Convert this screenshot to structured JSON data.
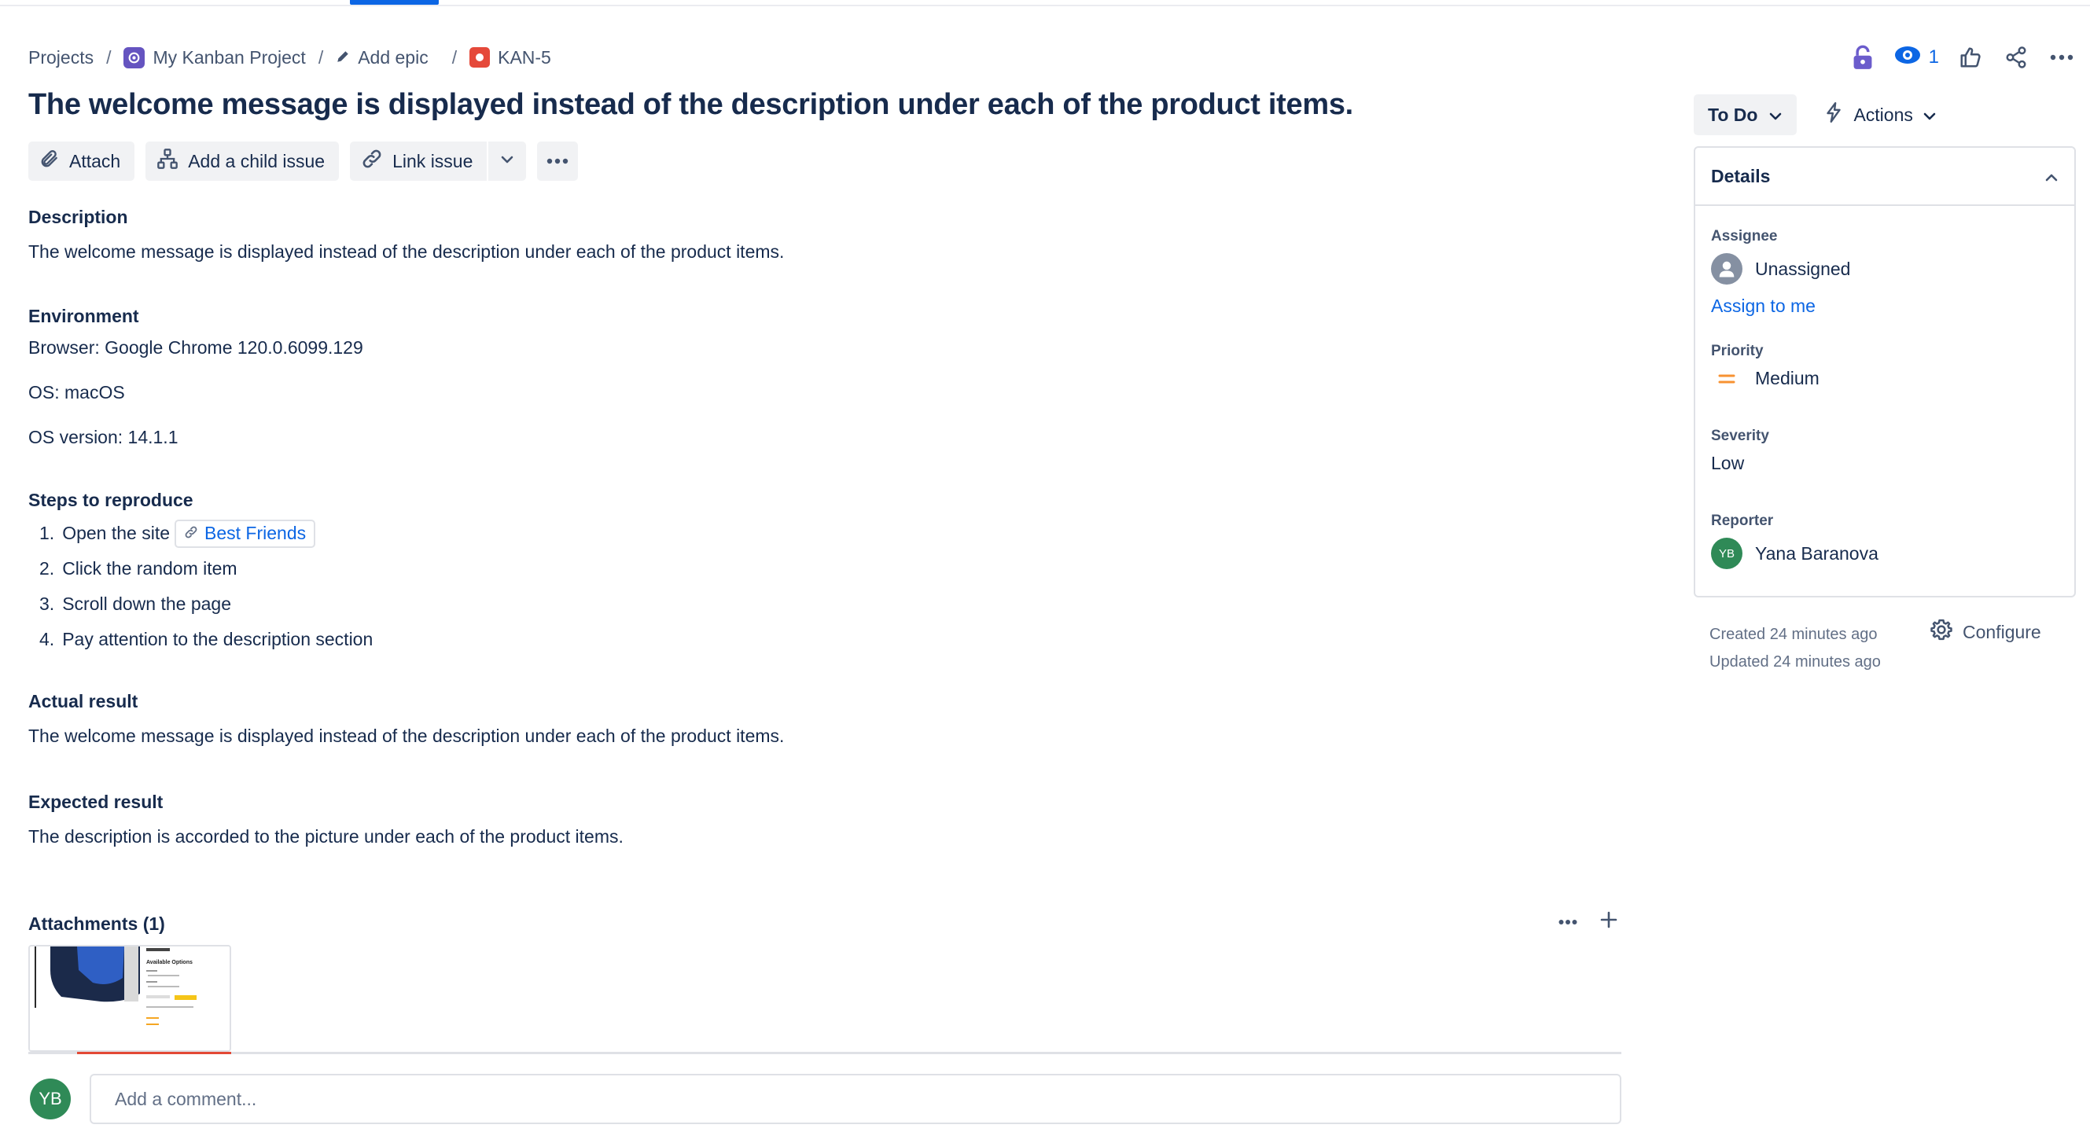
{
  "breadcrumb": {
    "projects": "Projects",
    "project_name": "My Kanban Project",
    "add_epic": "Add epic",
    "issue_key": "KAN-5",
    "separator": "/"
  },
  "top_actions": {
    "watchers_count": "1"
  },
  "issue": {
    "title": "The welcome message is displayed instead of the description under each of the product items."
  },
  "toolbar": {
    "attach": "Attach",
    "add_child": "Add a child issue",
    "link_issue": "Link issue"
  },
  "description": {
    "heading": "Description",
    "text": "The welcome message is displayed instead of the description under each of the product items."
  },
  "environment": {
    "heading": "Environment",
    "browser": "Browser: Google Chrome 120.0.6099.129",
    "os": "OS: macOS",
    "os_version": "OS version: 14.1.1"
  },
  "steps": {
    "heading": "Steps to reproduce",
    "items": [
      {
        "num": "1.",
        "text": "Open the site",
        "link": "Best Friends"
      },
      {
        "num": "2.",
        "text": "Click the random item"
      },
      {
        "num": "3.",
        "text": "Scroll down the page"
      },
      {
        "num": "4.",
        "text": "Pay attention to the description section"
      }
    ]
  },
  "actual": {
    "heading": "Actual result",
    "text": "The welcome message is displayed instead of the description under each of the product items."
  },
  "expected": {
    "heading": "Expected result",
    "text": "The description is accorded to the picture under each of the product items."
  },
  "attachments": {
    "heading": "Attachments (1)",
    "thumb_title": "Available Options"
  },
  "comment": {
    "avatar_initials": "YB",
    "placeholder": "Add a comment..."
  },
  "side": {
    "status": "To Do",
    "actions": "Actions",
    "details_heading": "Details",
    "assignee_label": "Assignee",
    "assignee_value": "Unassigned",
    "assign_to_me": "Assign to me",
    "priority_label": "Priority",
    "priority_value": "Medium",
    "severity_label": "Severity",
    "severity_value": "Low",
    "reporter_label": "Reporter",
    "reporter_initials": "YB",
    "reporter_value": "Yana Baranova",
    "created": "Created 24 minutes ago",
    "updated": "Updated 24 minutes ago",
    "configure": "Configure"
  },
  "colors": {
    "accent": "#0c66e4",
    "priority_medium": "#f79232",
    "issue_type_bug": "#e5493a",
    "avatar_green": "#2f8a57"
  }
}
